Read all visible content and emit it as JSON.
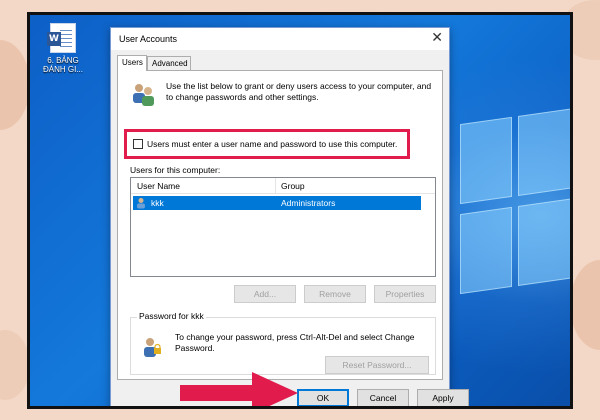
{
  "desktop": {
    "word_icon_letter": "W",
    "word_icon_label": "6. BẢNG ĐÁNH GI..."
  },
  "dialog": {
    "title": "User Accounts",
    "close_glyph": "✕",
    "tabs": [
      {
        "label": "Users",
        "active": true
      },
      {
        "label": "Advanced",
        "active": false
      }
    ],
    "intro_text": "Use the list below to grant or deny users access to your computer, and to change passwords and other settings.",
    "require_login_checkbox": {
      "label": "Users must enter a user name and password to use this computer.",
      "checked": false
    },
    "users_section_label": "Users for this computer:",
    "list": {
      "columns": [
        "User Name",
        "Group"
      ],
      "rows": [
        {
          "user": "kkk",
          "group": "Administrators",
          "selected": true
        }
      ]
    },
    "buttons": {
      "add": "Add...",
      "remove": "Remove",
      "properties": "Properties",
      "reset_password": "Reset Password...",
      "ok": "OK",
      "cancel": "Cancel",
      "apply": "Apply"
    },
    "password_group": {
      "title": "Password for kkk",
      "text": "To change your password, press Ctrl-Alt-Del and select Change Password."
    }
  },
  "colors": {
    "highlight_box": "#e21b4d",
    "arrow": "#e21b4d",
    "selection": "#0078d7",
    "desktop": "#1479db"
  }
}
